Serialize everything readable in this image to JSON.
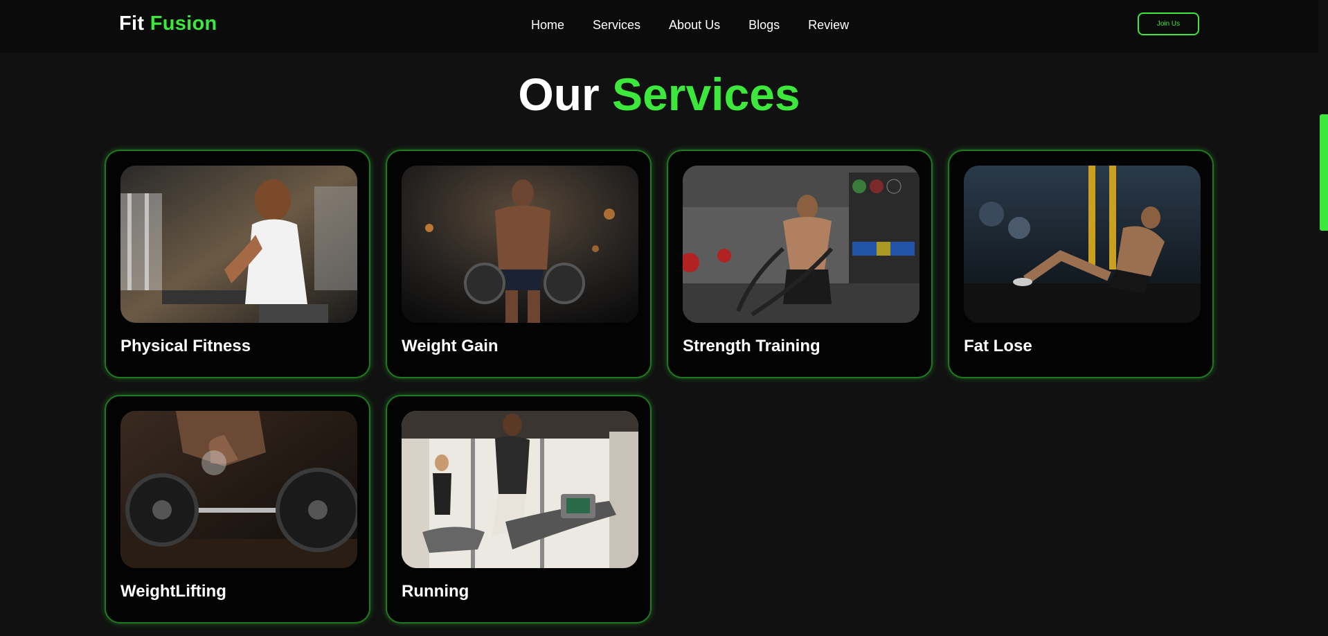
{
  "header": {
    "logo_part1": "Fit",
    "logo_part2": "Fusion",
    "nav": [
      "Home",
      "Services",
      "About Us",
      "Blogs",
      "Review"
    ],
    "join_label": "Join Us"
  },
  "section": {
    "title_part1": "Our",
    "title_part2": "Services"
  },
  "services": [
    {
      "label": "Physical Fitness",
      "image": "gym-person-sitting-image"
    },
    {
      "label": "Weight Gain",
      "image": "bodybuilder-image"
    },
    {
      "label": "Strength Training",
      "image": "battle-ropes-image"
    },
    {
      "label": "Fat Lose",
      "image": "situps-image"
    },
    {
      "label": "WeightLifting",
      "image": "barbell-image"
    },
    {
      "label": "Running",
      "image": "treadmill-image"
    }
  ],
  "colors": {
    "accent": "#3be83b",
    "background": "#111111",
    "card": "#030303",
    "header": "#0b0b0b"
  }
}
